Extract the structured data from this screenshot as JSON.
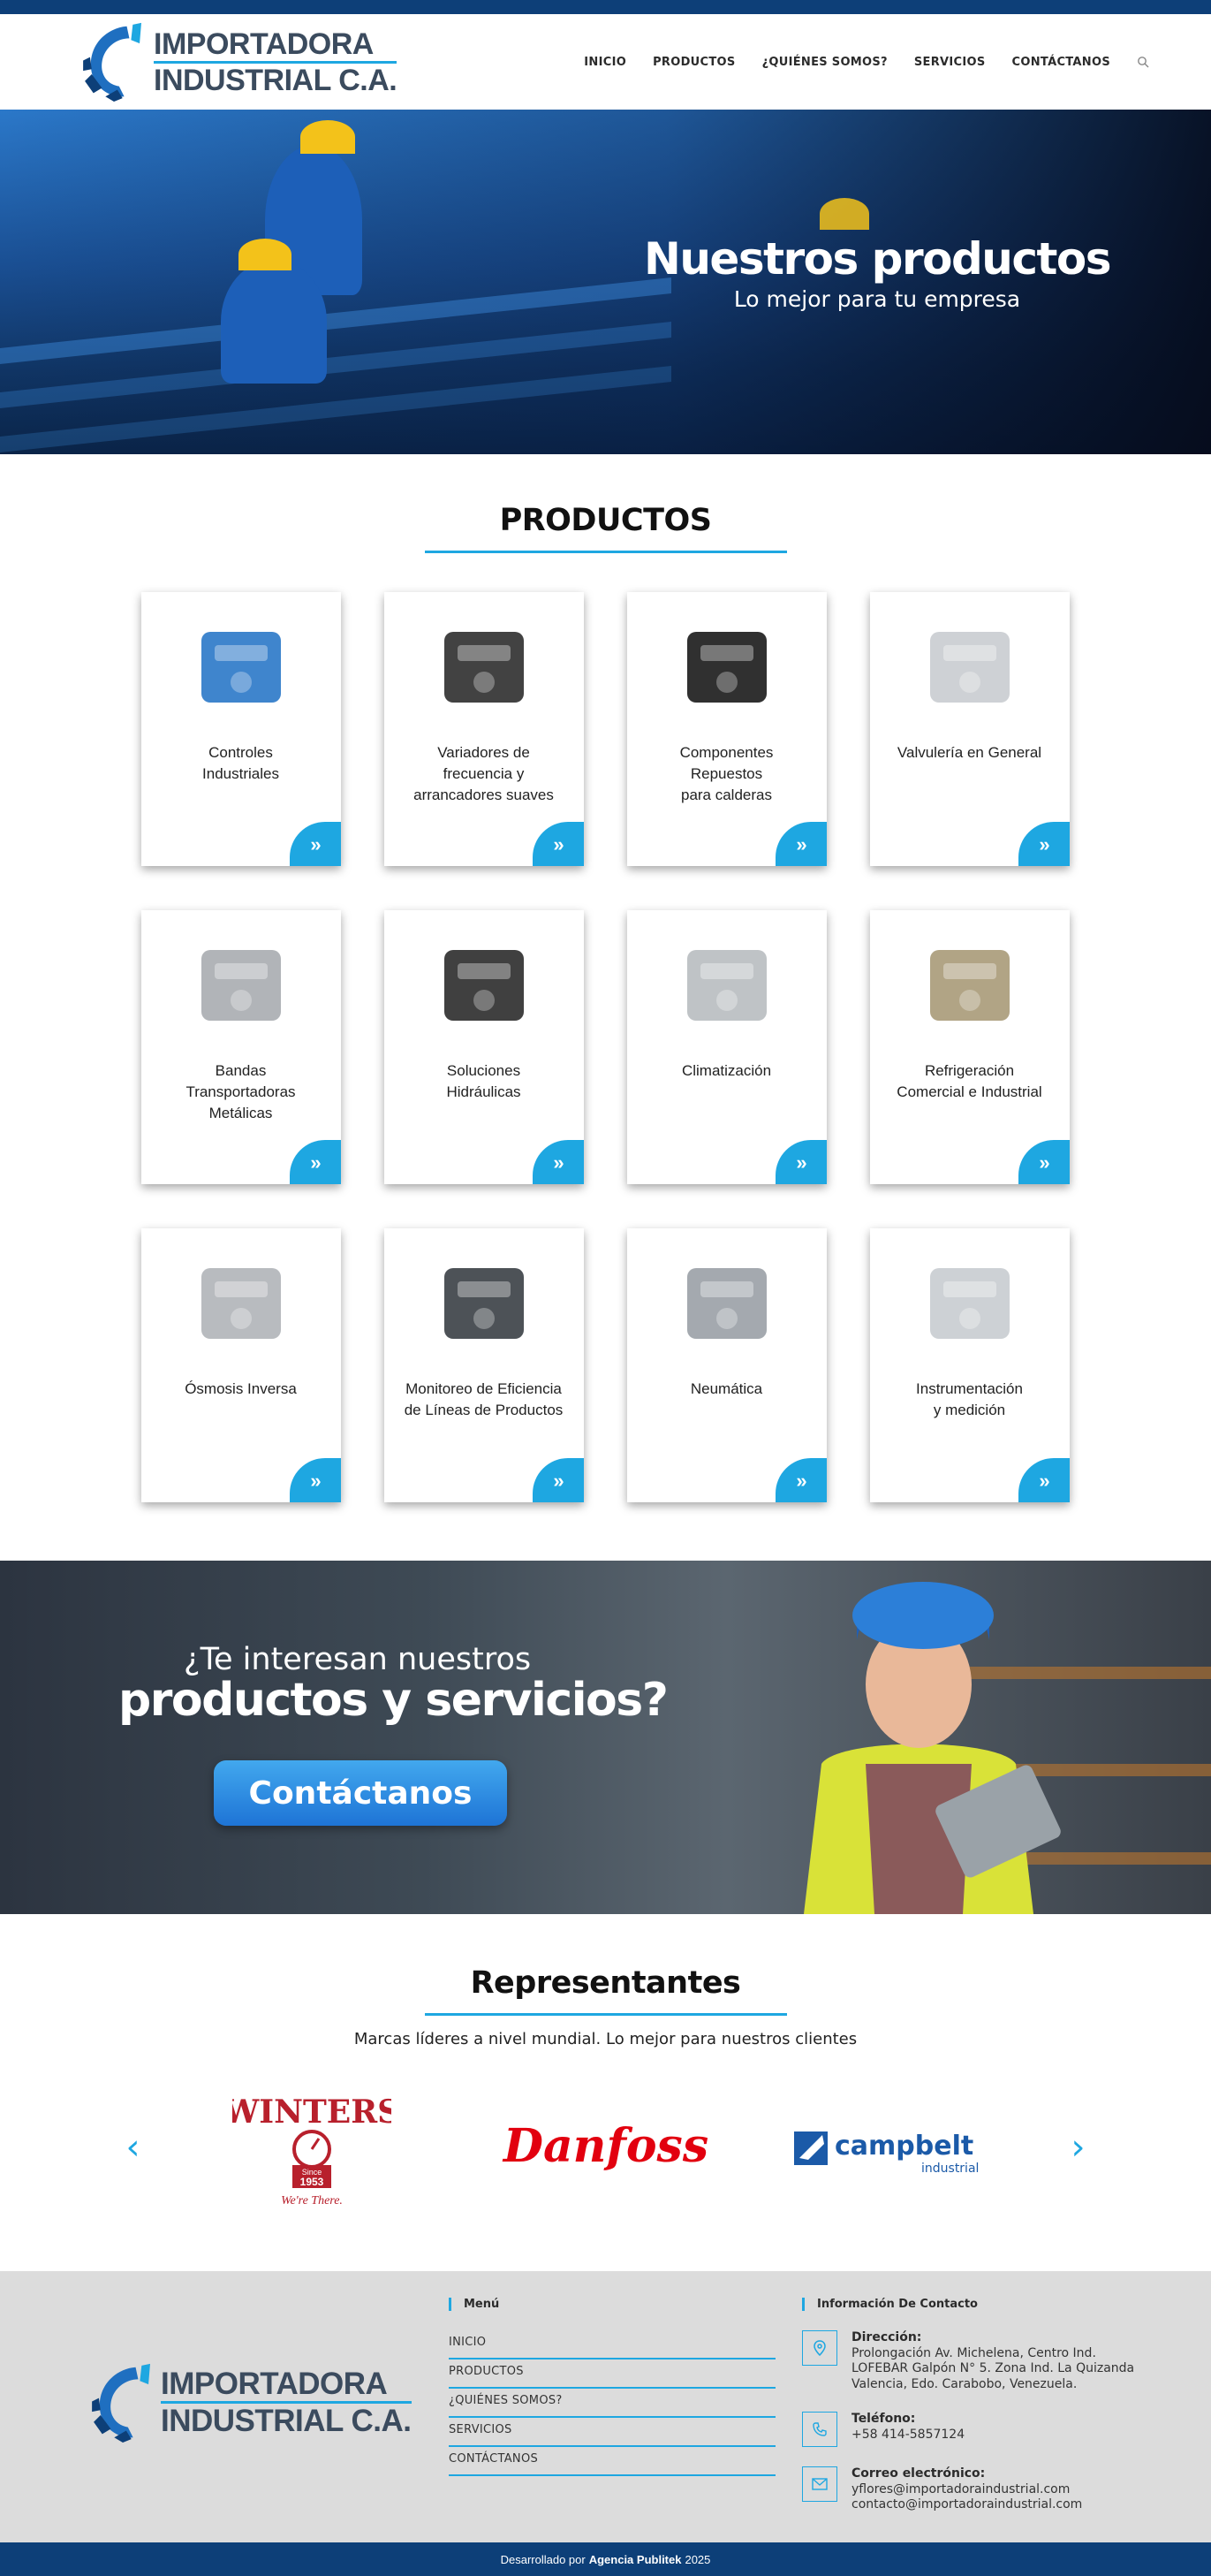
{
  "header": {
    "logo_line1": "IMPORTADORA",
    "logo_line2": "INDUSTRIAL C.A.",
    "nav": [
      "INICIO",
      "PRODUCTOS",
      "¿QUIÉNES SOMOS?",
      "SERVICIOS",
      "CONTÁCTANOS"
    ],
    "search_icon": "search-icon"
  },
  "hero": {
    "title": "Nuestros productos",
    "subtitle": "Lo mejor para tu empresa"
  },
  "products": {
    "title": "PRODUCTOS",
    "items": [
      "Controles\nIndustriales",
      "Variadores de\nfrecuencia y\narrancadores suaves",
      "Componentes\nRepuestos\npara calderas",
      "Valvulería en General",
      "Bandas\nTransportadoras\nMetálicas",
      "Soluciones\nHidráulicas",
      "Climatización",
      "Refrigeración\nComercial e Industrial",
      "Ósmosis Inversa",
      "Monitoreo de Eficiencia\nde Líneas de Productos",
      "Neumática",
      "Instrumentación\ny medición"
    ],
    "button_icon": "double-chevron-right-icon"
  },
  "cta": {
    "line1": "¿Te interesan nuestros",
    "line2": "productos y servicios?",
    "button": "Contáctanos"
  },
  "reps": {
    "title": "Representantes",
    "subtitle": "Marcas líderes a nivel mundial. Lo mejor para nuestros clientes",
    "brands": [
      "WINTERS",
      "Danfoss",
      "campbelt"
    ],
    "winters_since": "Since",
    "winters_year": "1953",
    "winters_tag": "We're There.",
    "campbelt_sub": "industrial"
  },
  "footer": {
    "logo_line1": "IMPORTADORA",
    "logo_line2": "INDUSTRIAL C.A.",
    "menu_title": "Menú",
    "menu": [
      "INICIO",
      "PRODUCTOS",
      "¿QUIÉNES SOMOS?",
      "SERVICIOS",
      "CONTÁCTANOS"
    ],
    "contact_title": "Información De Contacto",
    "address_label": "Dirección:",
    "address": "Prolongación Av. Michelena, Centro Ind. LOFEBAR Galpón N° 5. Zona Ind. La Quizanda Valencia, Edo. Carabobo, Venezuela.",
    "phone_label": "Teléfono:",
    "phone": "+58 414-5857124",
    "email_label": "Correo electrónico:",
    "email1": "yflores@importadoraindustrial.com",
    "email2": "contacto@importadoraindustrial.com"
  },
  "bottombar": {
    "prefix": "Desarrollado por",
    "agency": "Agencia Publitek",
    "year": "2025"
  },
  "colors": {
    "brand_dark": "#0d3f78",
    "accent": "#1ea7e1"
  }
}
